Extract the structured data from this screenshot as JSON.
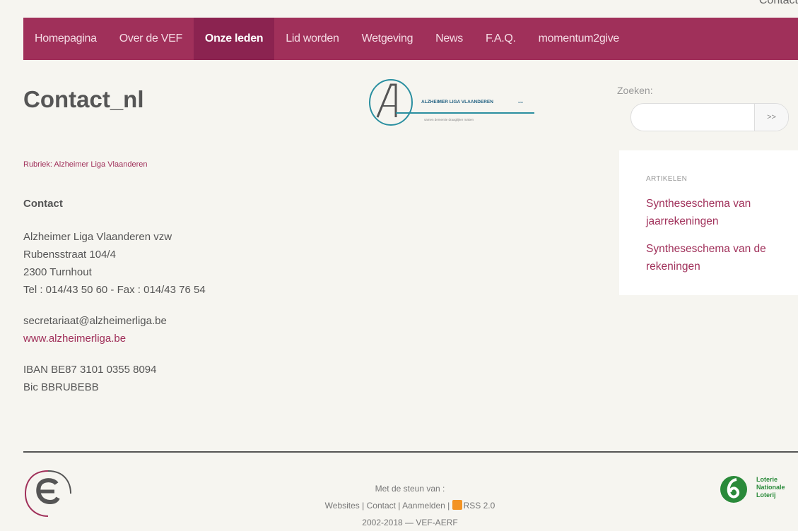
{
  "top_link": "Contact",
  "nav": {
    "items": [
      {
        "label": "Homepagina"
      },
      {
        "label": "Over de VEF"
      },
      {
        "label": "Onze leden"
      },
      {
        "label": "Lid worden"
      },
      {
        "label": "Wetgeving"
      },
      {
        "label": "News"
      },
      {
        "label": "F.A.Q."
      },
      {
        "label": "momentum2give"
      }
    ],
    "active_index": 2
  },
  "page": {
    "title": "Contact_nl",
    "rubriek": "Rubriek: Alzheimer Liga Vlaanderen"
  },
  "logo": {
    "name": "ALZHEIMER LIGA VLAANDEREN",
    "suffix": "vzw",
    "tagline": "samen dementie draaglijker maken"
  },
  "search": {
    "label": "Zoeken:",
    "value": "",
    "button": ">>"
  },
  "contact": {
    "heading": "Contact",
    "org": "Alzheimer Liga Vlaanderen vzw",
    "street": "Rubensstraat 104/4",
    "city": "2300 Turnhout",
    "phone": "Tel : 014/43 50 60 - Fax : 014/43 76 54",
    "email": "secretariaat@alzheimerliga.be",
    "website": "www.alzheimerliga.be",
    "iban": "IBAN BE87 3101 0355 8094",
    "bic": "Bic BBRUBEBB"
  },
  "sidebar": {
    "title": "ARTIKELEN",
    "items": [
      {
        "label": "Syntheseschema van jaarrekeningen"
      },
      {
        "label": "Syntheseschema van de rekeningen"
      }
    ]
  },
  "footer": {
    "support": "Met de steun van :",
    "links": [
      "Websites",
      "Contact",
      "Aanmelden",
      "RSS 2.0"
    ],
    "copyright": "2002-2018 — VEF-AERF",
    "lotto": [
      "Loterie",
      "Nationale",
      "Loterij"
    ]
  },
  "colors": {
    "accent": "#a0305a",
    "nav_active": "#8b2350",
    "background": "#f6f5f0"
  }
}
